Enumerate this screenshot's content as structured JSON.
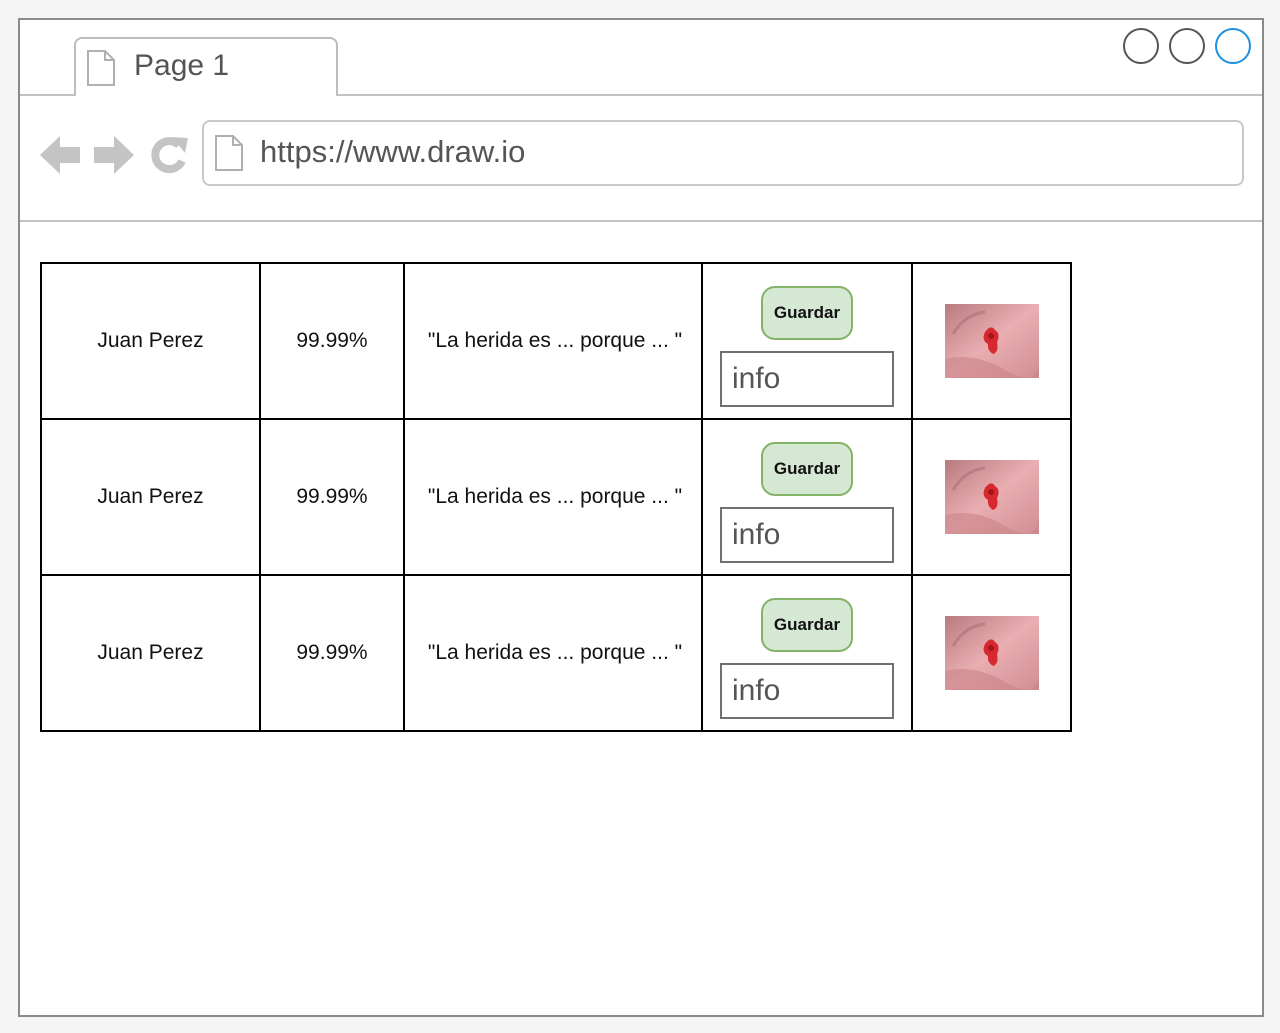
{
  "browser": {
    "tab_title": "Page 1",
    "url": "https://www.draw.io",
    "accent_color": "#1e90e0"
  },
  "icons": {
    "tab": "page-icon",
    "back": "arrow-left-icon",
    "forward": "arrow-right-icon",
    "reload": "reload-icon",
    "url": "page-icon"
  },
  "table": {
    "rows": [
      {
        "name": "Juan Perez",
        "percent": "99.99%",
        "note": "\"La herida es ... porque ... \"",
        "save_label": "Guardar",
        "info_value": "info"
      },
      {
        "name": "Juan Perez",
        "percent": "99.99%",
        "note": "\"La herida es ... porque ... \"",
        "save_label": "Guardar",
        "info_value": "info"
      },
      {
        "name": "Juan Perez",
        "percent": "99.99%",
        "note": "\"La herida es ... porque ... \"",
        "save_label": "Guardar",
        "info_value": "info"
      }
    ]
  },
  "colors": {
    "button_fill": "#d5e8d4",
    "button_border": "#82b366"
  }
}
